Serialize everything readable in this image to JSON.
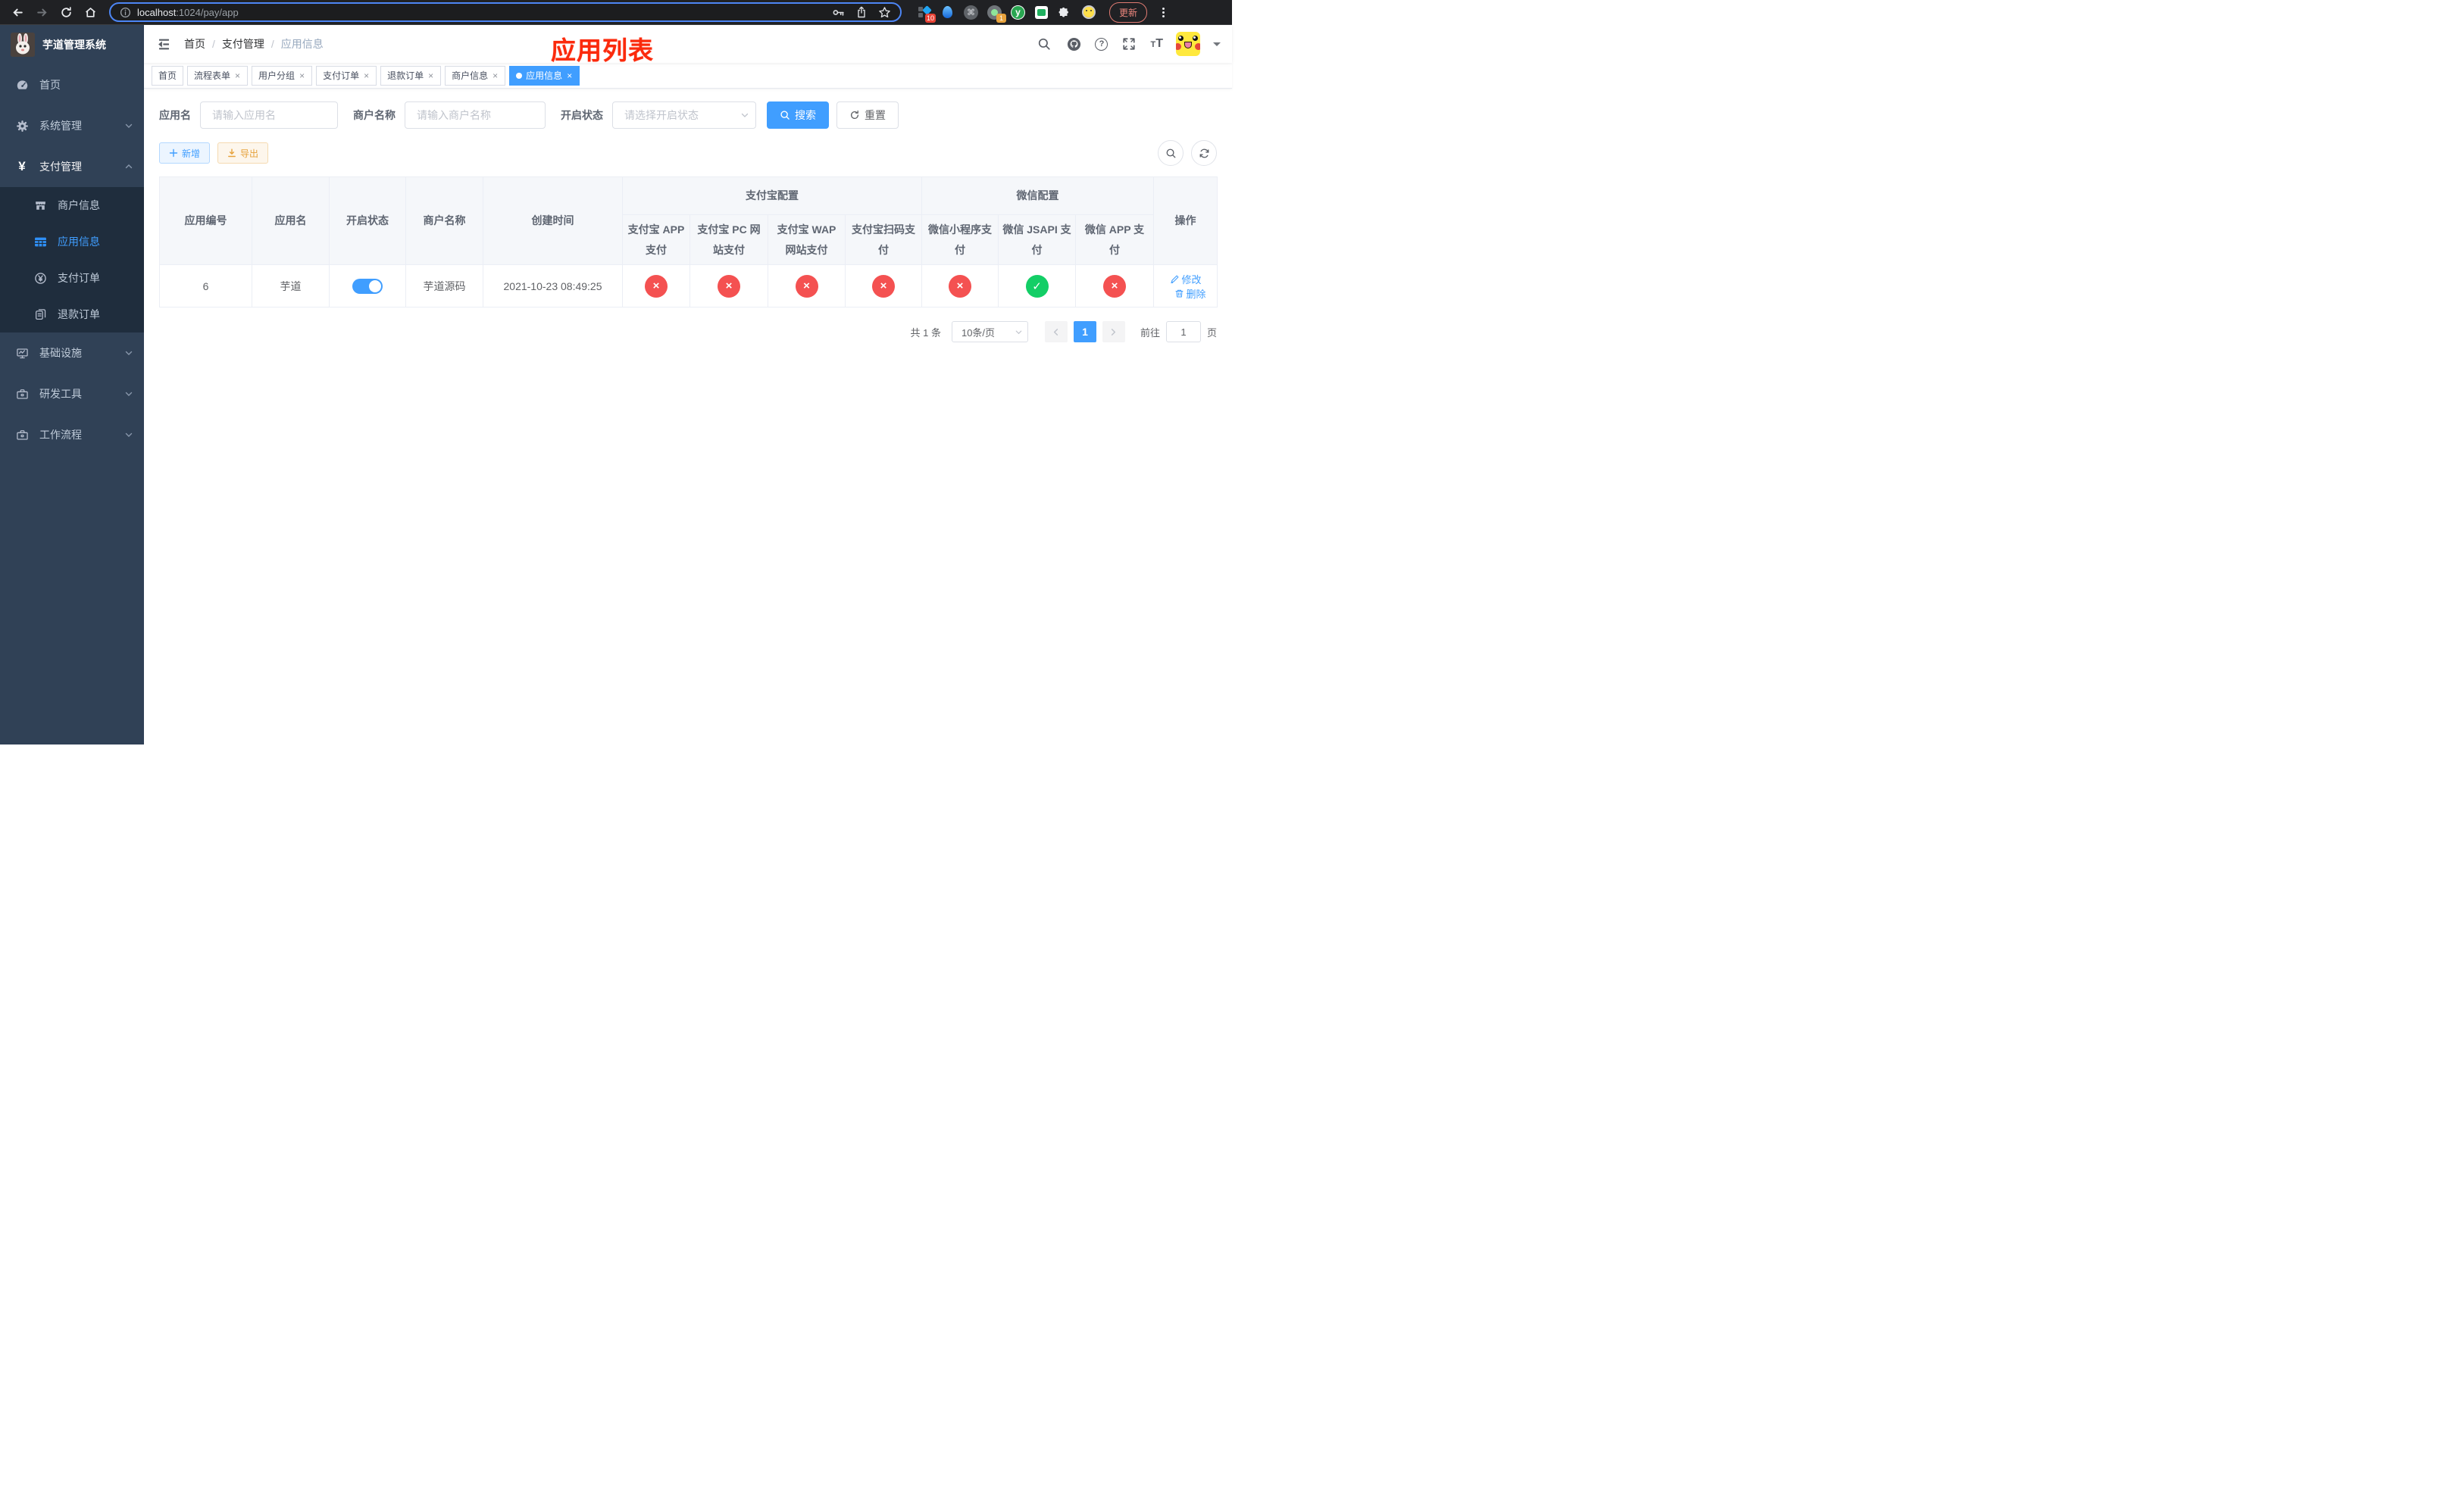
{
  "browser": {
    "url": {
      "host": "localhost",
      "path": ":1024/pay/app"
    },
    "update_label": "更新",
    "ext_badges": {
      "pin": "10",
      "proxy": "1"
    }
  },
  "sidebar": {
    "logo_title": "芋道管理系统",
    "items": {
      "home": "首页",
      "system": "系统管理",
      "payment": "支付管理",
      "merchant": "商户信息",
      "app": "应用信息",
      "pay_order": "支付订单",
      "refund_order": "退款订单",
      "infra": "基础设施",
      "devtools": "研发工具",
      "workflow": "工作流程"
    }
  },
  "navbar": {
    "breadcrumb": [
      "首页",
      "支付管理",
      "应用信息"
    ]
  },
  "annotation": "应用列表",
  "tabs": [
    {
      "label": "首页"
    },
    {
      "label": "流程表单"
    },
    {
      "label": "用户分组"
    },
    {
      "label": "支付订单"
    },
    {
      "label": "退款订单"
    },
    {
      "label": "商户信息"
    },
    {
      "label": "应用信息"
    }
  ],
  "filters": {
    "app_name": {
      "label": "应用名",
      "placeholder": "请输入应用名"
    },
    "merchant": {
      "label": "商户名称",
      "placeholder": "请输入商户名称"
    },
    "status": {
      "label": "开启状态",
      "placeholder": "请选择开启状态"
    },
    "search": "搜索",
    "reset": "重置"
  },
  "toolbar": {
    "add": "新增",
    "export": "导出"
  },
  "table": {
    "groups": {
      "alipay": "支付宝配置",
      "wechat": "微信配置"
    },
    "headers": [
      "应用编号",
      "应用名",
      "开启状态",
      "商户名称",
      "创建时间",
      "支付宝 APP 支付",
      "支付宝 PC 网站支付",
      "支付宝 WAP 网站支付",
      "支付宝扫码支付",
      "微信小程序支付",
      "微信 JSAPI 支付",
      "微信 APP 支付",
      "操作"
    ],
    "row": {
      "id": "6",
      "name": "芋道",
      "enabled": true,
      "merchant": "芋道源码",
      "created": "2021-10-23 08:49:25",
      "statuses": [
        false,
        false,
        false,
        false,
        false,
        true,
        false
      ],
      "edit": "修改",
      "delete": "删除"
    }
  },
  "pagination": {
    "total": "共 1 条",
    "page_size": "10条/页",
    "page": "1",
    "goto": "前往",
    "unit": "页",
    "jump_value": "1"
  }
}
